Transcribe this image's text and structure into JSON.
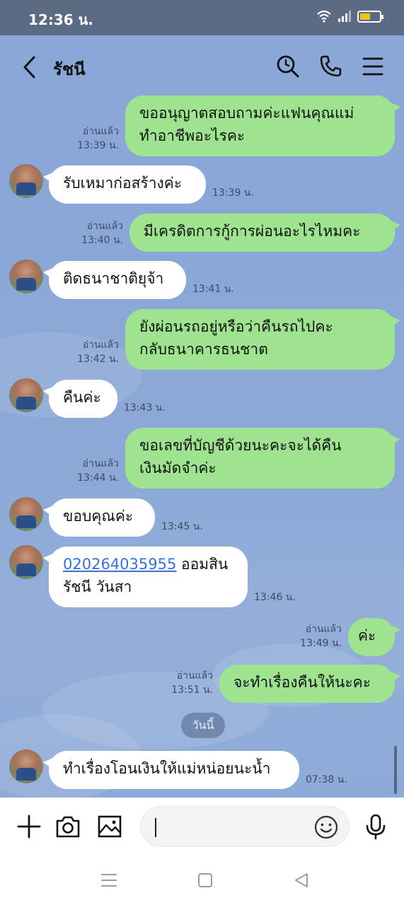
{
  "status_bar": {
    "time": "12:36 น.",
    "battery_level": 0.55,
    "battery_color": "#f0c419"
  },
  "header": {
    "title": "รัชนี"
  },
  "icons": {
    "back": "chevron-left-icon",
    "search": "search-icon",
    "call": "phone-icon",
    "menu": "hamburger-menu-icon"
  },
  "messages": [
    {
      "dir": "out",
      "lines": [
        "ขออนุญาตสอบถามค่ะแฟนคุณแม่",
        "ทำอาชีพอะไรคะ"
      ],
      "read": "อ่านแล้ว",
      "time": "13:39 น."
    },
    {
      "dir": "in",
      "lines": [
        "รับเหมาก่อสร้างค่ะ"
      ],
      "time": "13:39 น."
    },
    {
      "dir": "out",
      "lines": [
        "มีเครดิตการกู้การผ่อนอะไรไหมคะ"
      ],
      "read": "อ่านแล้ว",
      "time": "13:40 น."
    },
    {
      "dir": "in",
      "lines": [
        "ติดธนาชาติยุจ้า"
      ],
      "time": "13:41 น."
    },
    {
      "dir": "out",
      "lines": [
        "ยังผ่อนรถอยู่หรือว่าคืนรถไปคะ",
        "กลับธนาคารธนชาต"
      ],
      "read": "อ่านแล้ว",
      "time": "13:42 น."
    },
    {
      "dir": "in",
      "lines": [
        "คืนค่ะ"
      ],
      "time": "13:43 น."
    },
    {
      "dir": "out",
      "lines": [
        "ขอเลขที่บัญชีด้วยนะคะจะได้คืน",
        "เงินมัดจำค่ะ"
      ],
      "read": "อ่านแล้ว",
      "time": "13:44 น."
    },
    {
      "dir": "in",
      "lines": [
        "ขอบคุณค่ะ"
      ],
      "time": "13:45 น."
    },
    {
      "dir": "in",
      "link": "020264035955",
      "link_suffix": " ออมสิน",
      "lines": [
        "รัชนี  วันสา"
      ],
      "time": "13:46 น."
    },
    {
      "dir": "out",
      "lines": [
        "ค่ะ"
      ],
      "read": "อ่านแล้ว",
      "time": "13:49 น."
    },
    {
      "dir": "out",
      "lines": [
        "จะทำเรื่องคืนให้นะคะ"
      ],
      "read": "อ่านแล้ว",
      "time": "13:51 น."
    },
    {
      "dir": "in",
      "lines": [
        "ทำเรื่องโอนเงินให้แม่หน่อยนะน้ำ"
      ],
      "time": "07:38 น."
    }
  ],
  "date_separator": "วันนี้",
  "input_bar": {
    "plus_icon": "plus-icon",
    "camera_icon": "camera-icon",
    "image_icon": "image-icon",
    "emoji_icon": "emoji-icon",
    "mic_icon": "microphone-icon",
    "value": ""
  },
  "nav_bar": {
    "recent": "recent-apps-icon",
    "home": "home-icon",
    "back": "back-triangle-icon"
  },
  "colors": {
    "outgoing": "#9ee38f",
    "incoming": "#ffffff",
    "chat_bg": "#8aa7d8",
    "link": "#3b6fd6"
  }
}
